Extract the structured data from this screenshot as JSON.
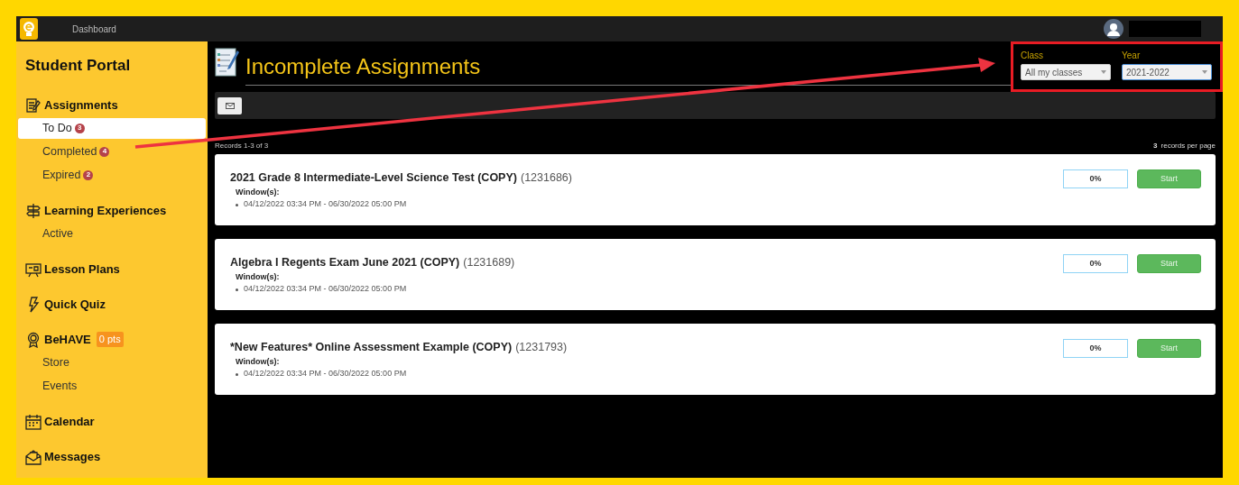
{
  "topbar": {
    "link": "Dashboard"
  },
  "sidebar": {
    "title": "Student Portal",
    "sections": [
      {
        "label": "Assignments",
        "children": [
          {
            "label": "To Do",
            "badge": "3",
            "selected": true
          },
          {
            "label": "Completed",
            "badge": "4",
            "selected": false
          },
          {
            "label": "Expired",
            "badge": "2",
            "selected": false
          }
        ]
      },
      {
        "label": "Learning Experiences",
        "children": [
          {
            "label": "Active",
            "selected": false
          }
        ]
      },
      {
        "label": "Lesson Plans"
      },
      {
        "label": "Quick Quiz"
      },
      {
        "label": "BeHAVE",
        "points": "0 pts",
        "children": [
          {
            "label": "Store",
            "selected": false
          },
          {
            "label": "Events",
            "selected": false
          }
        ]
      },
      {
        "label": "Calendar"
      },
      {
        "label": "Messages"
      }
    ]
  },
  "page": {
    "title": "Incomplete Assignments"
  },
  "filters": [
    {
      "label": "Class",
      "value": "All my classes",
      "focused": false
    },
    {
      "label": "Year",
      "value": "2021-2022",
      "focused": true
    }
  ],
  "records": {
    "summary": "Records 1-3 of 3",
    "per_page_count": "3",
    "per_page_label": "records per page"
  },
  "assignments": [
    {
      "title": "2021 Grade 8 Intermediate-Level Science Test (COPY)",
      "id": "(1231686)",
      "window_label": "Window(s):",
      "windows": [
        "04/12/2022 03:34 PM - 06/30/2022 05:00 PM"
      ],
      "progress": "0%",
      "button": "Start"
    },
    {
      "title": "Algebra I Regents Exam June 2021 (COPY)",
      "id": "(1231689)",
      "window_label": "Window(s):",
      "windows": [
        "04/12/2022 03:34 PM - 06/30/2022 05:00 PM"
      ],
      "progress": "0%",
      "button": "Start"
    },
    {
      "title": "*New Features* Online Assessment Example (COPY)",
      "id": "(1231793)",
      "window_label": "Window(s):",
      "windows": [
        "04/12/2022 03:34 PM - 06/30/2022 05:00 PM"
      ],
      "progress": "0%",
      "button": "Start"
    }
  ]
}
